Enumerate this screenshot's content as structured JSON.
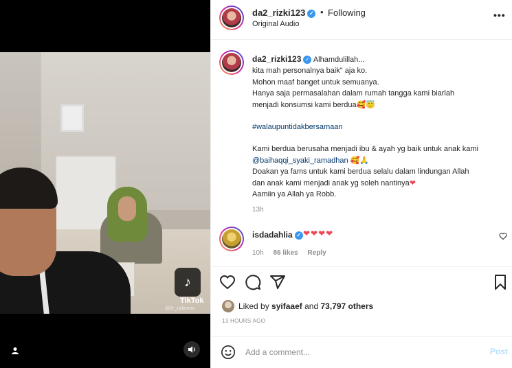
{
  "media": {
    "watermark_brand": "TikTok",
    "watermark_handle": "@2r_rizkinmo",
    "tag_icon": "user-tag-icon",
    "sound_icon": "speaker-icon"
  },
  "header": {
    "username": "da2_rizki123",
    "separator": "•",
    "follow_status": "Following",
    "audio": "Original Audio",
    "more": "•••"
  },
  "caption": {
    "username": "da2_rizki123",
    "lines": [
      "Alhamdulillah...",
      "kita mah personalnya baik\" aja ko.",
      "Mohon maaf banget untuk semuanya.",
      "Hanya saja permasalahan dalam rumah tangga kami biarlah",
      "menjadi konsumsi kami berdua"
    ],
    "emoji_1": "🥰😇",
    "hashtag": "#walaupuntidakbersamaan",
    "body_1": "Kami berdua berusaha menjadi ibu & ayah yg baik untuk anak kami",
    "mention": "@baihaqqi_syaki_ramadhan",
    "emoji_2": "🥰🙏",
    "body_2": "Doakan ya fams untuk kami berdua selalu dalam lindungan Allah",
    "body_3": "dan anak kami menjadi anak yg soleh nantinya",
    "heart": "❤",
    "body_4": "Aamiin ya Allah ya Robb.",
    "time": "13h"
  },
  "comment": {
    "username": "isdadahlia",
    "text": "❤❤❤❤",
    "time": "10h",
    "likes": "86 likes",
    "reply": "Reply"
  },
  "likes": {
    "prefix": "Liked by",
    "user": "syifaaef",
    "mid": "and",
    "count": "73,797 others"
  },
  "post_time": "13 HOURS AGO",
  "add_comment": {
    "placeholder": "Add a comment...",
    "post_label": "Post"
  },
  "colors": {
    "link": "#00376b",
    "heart": "#ed4956",
    "verified": "#3897f0",
    "post_disabled": "#b2dffc"
  }
}
